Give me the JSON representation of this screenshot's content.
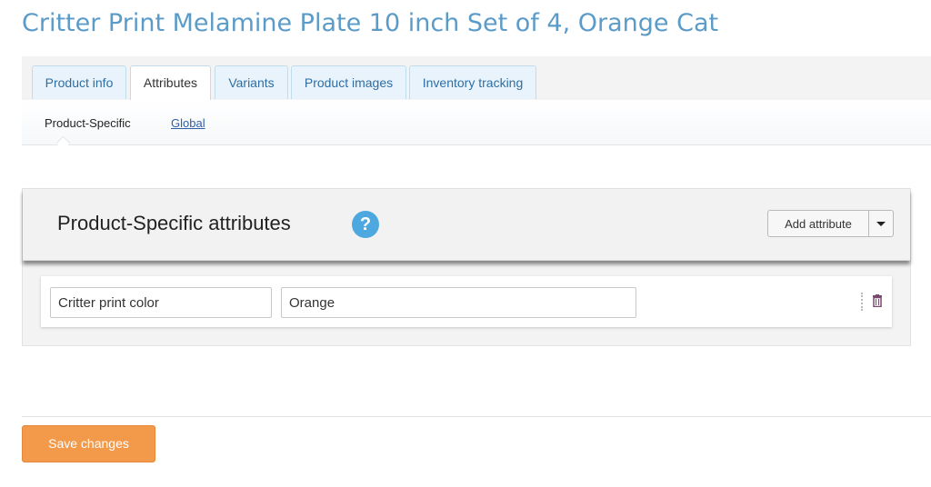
{
  "page": {
    "title": "Critter Print Melamine Plate 10 inch Set of 4, Orange Cat"
  },
  "tabs": [
    {
      "label": "Product info",
      "active": false
    },
    {
      "label": "Attributes",
      "active": true
    },
    {
      "label": "Variants",
      "active": false
    },
    {
      "label": "Product images",
      "active": false
    },
    {
      "label": "Inventory tracking",
      "active": false
    }
  ],
  "subtabs": [
    {
      "label": "Product-Specific",
      "current": true
    },
    {
      "label": "Global",
      "current": false
    }
  ],
  "panel": {
    "title": "Product-Specific attributes",
    "help_icon": "?",
    "add_button": "Add attribute"
  },
  "attributes": [
    {
      "name": "Critter print color",
      "value": "Orange"
    }
  ],
  "footer": {
    "save_label": "Save changes"
  },
  "colors": {
    "title": "#5b9bc8",
    "tab_bg": "#e8f3fb",
    "link": "#2f5fa8",
    "help": "#4ea8e0",
    "save": "#f2994a"
  },
  "icons": [
    "help-icon",
    "chevron-down-icon",
    "drag-handle-icon",
    "trash-icon"
  ]
}
